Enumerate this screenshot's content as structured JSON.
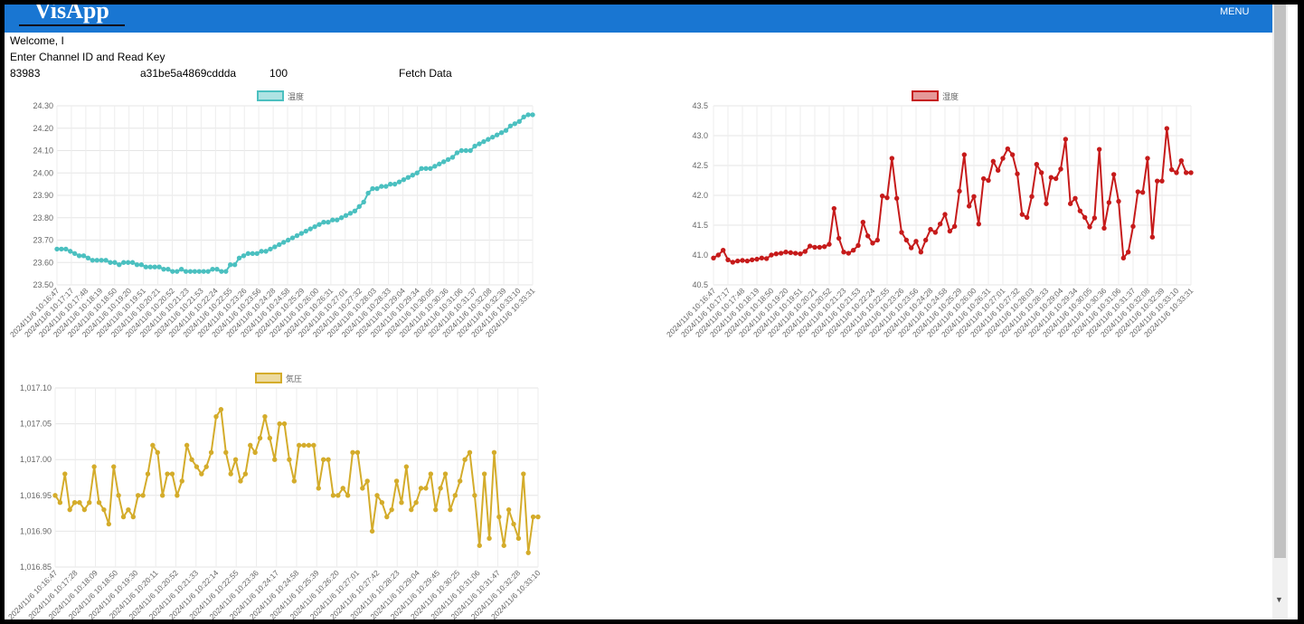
{
  "app": {
    "brand": "VisApp",
    "menu_label": "MENU"
  },
  "page": {
    "welcome": "Welcome, I",
    "prompt": "Enter Channel ID and Read Key",
    "channel_id": "83983",
    "read_key": "a31be5a4869cddda",
    "results": "100",
    "fetch_label": "Fetch Data"
  },
  "chart_data": [
    {
      "type": "line",
      "series": [
        {
          "name": "温度",
          "color": "#4bc0c0",
          "values": [
            23.66,
            23.66,
            23.66,
            23.65,
            23.64,
            23.63,
            23.63,
            23.62,
            23.61,
            23.61,
            23.61,
            23.61,
            23.6,
            23.6,
            23.59,
            23.6,
            23.6,
            23.6,
            23.59,
            23.59,
            23.58,
            23.58,
            23.58,
            23.58,
            23.57,
            23.57,
            23.56,
            23.56,
            23.57,
            23.56,
            23.56,
            23.56,
            23.56,
            23.56,
            23.56,
            23.57,
            23.57,
            23.56,
            23.56,
            23.59,
            23.59,
            23.62,
            23.63,
            23.64,
            23.64,
            23.64,
            23.65,
            23.65,
            23.66,
            23.67,
            23.68,
            23.69,
            23.7,
            23.71,
            23.72,
            23.73,
            23.74,
            23.75,
            23.76,
            23.77,
            23.78,
            23.78,
            23.79,
            23.79,
            23.8,
            23.81,
            23.82,
            23.83,
            23.85,
            23.87,
            23.91,
            23.93,
            23.93,
            23.94,
            23.94,
            23.95,
            23.95,
            23.96,
            23.97,
            23.98,
            23.99,
            24.0,
            24.02,
            24.02,
            24.02,
            24.03,
            24.04,
            24.05,
            24.06,
            24.07,
            24.09,
            24.1,
            24.1,
            24.1,
            24.12,
            24.13,
            24.14,
            24.15,
            24.16,
            24.17,
            24.18,
            24.19,
            24.21,
            24.22,
            24.23,
            24.25,
            24.26,
            24.26
          ]
        }
      ],
      "x_labels": [
        "2024/11/6 10:16:47",
        "2024/11/6 10:17:17",
        "2024/11/6 10:17:48",
        "2024/11/6 10:18:19",
        "2024/11/6 10:18:50",
        "2024/11/6 10:19:20",
        "2024/11/6 10:19:51",
        "2024/11/6 10:20:21",
        "2024/11/6 10:20:52",
        "2024/11/6 10:21:23",
        "2024/11/6 10:21:53",
        "2024/11/6 10:22:24",
        "2024/11/6 10:22:55",
        "2024/11/6 10:23:26",
        "2024/11/6 10:23:56",
        "2024/11/6 10:24:28",
        "2024/11/6 10:24:58",
        "2024/11/6 10:25:29",
        "2024/11/6 10:26:00",
        "2024/11/6 10:26:31",
        "2024/11/6 10:27:01",
        "2024/11/6 10:27:32",
        "2024/11/6 10:28:03",
        "2024/11/6 10:28:33",
        "2024/11/6 10:29:04",
        "2024/11/6 10:29:34",
        "2024/11/6 10:30:05",
        "2024/11/6 10:30:36",
        "2024/11/6 10:31:06",
        "2024/11/6 10:31:37",
        "2024/11/6 10:32:08",
        "2024/11/6 10:32:39",
        "2024/11/6 10:33:10",
        "2024/11/6 10:33:31"
      ],
      "y_ticks": [
        "24.30",
        "24.20",
        "24.10",
        "24.00",
        "23.90",
        "23.80",
        "23.70",
        "23.60",
        "23.50"
      ],
      "ylim": [
        23.5,
        24.3
      ],
      "grid": true,
      "legend_position": "top"
    },
    {
      "type": "line",
      "series": [
        {
          "name": "湿度",
          "color": "#c61b1b",
          "values": [
            40.95,
            41.0,
            41.08,
            40.92,
            40.88,
            40.9,
            40.91,
            40.9,
            40.92,
            40.93,
            40.95,
            40.94,
            41.0,
            41.02,
            41.03,
            41.05,
            41.04,
            41.03,
            41.02,
            41.06,
            41.15,
            41.13,
            41.13,
            41.14,
            41.18,
            41.78,
            41.28,
            41.05,
            41.03,
            41.08,
            41.16,
            41.55,
            41.32,
            41.2,
            41.25,
            41.99,
            41.96,
            42.62,
            41.95,
            41.38,
            41.25,
            41.12,
            41.23,
            41.05,
            41.25,
            41.43,
            41.38,
            41.52,
            41.68,
            41.4,
            41.48,
            42.07,
            42.68,
            41.82,
            41.98,
            41.52,
            42.28,
            42.25,
            42.57,
            42.42,
            42.62,
            42.78,
            42.68,
            42.36,
            41.68,
            41.63,
            41.98,
            42.52,
            42.38,
            41.86,
            42.3,
            42.28,
            42.44,
            42.94,
            41.86,
            41.95,
            41.74,
            41.63,
            41.47,
            41.62,
            42.77,
            41.45,
            41.88,
            42.35,
            41.9,
            40.95,
            41.05,
            41.48,
            42.06,
            42.05,
            42.62,
            41.3,
            42.24,
            42.24,
            43.12,
            42.43,
            42.38,
            42.58,
            42.38,
            42.38
          ]
        }
      ],
      "x_labels": [
        "2024/11/6 10:16:47",
        "2024/11/6 10:17:17",
        "2024/11/6 10:17:48",
        "2024/11/6 10:18:19",
        "2024/11/6 10:18:50",
        "2024/11/6 10:19:20",
        "2024/11/6 10:19:51",
        "2024/11/6 10:20:21",
        "2024/11/6 10:20:52",
        "2024/11/6 10:21:23",
        "2024/11/6 10:21:53",
        "2024/11/6 10:22:24",
        "2024/11/6 10:22:55",
        "2024/11/6 10:23:26",
        "2024/11/6 10:23:56",
        "2024/11/6 10:24:28",
        "2024/11/6 10:24:58",
        "2024/11/6 10:25:29",
        "2024/11/6 10:26:00",
        "2024/11/6 10:26:31",
        "2024/11/6 10:27:01",
        "2024/11/6 10:27:32",
        "2024/11/6 10:28:03",
        "2024/11/6 10:28:33",
        "2024/11/6 10:29:04",
        "2024/11/6 10:29:34",
        "2024/11/6 10:30:05",
        "2024/11/6 10:30:36",
        "2024/11/6 10:31:06",
        "2024/11/6 10:31:37",
        "2024/11/6 10:32:08",
        "2024/11/6 10:32:39",
        "2024/11/6 10:33:10",
        "2024/11/6 10:33:31"
      ],
      "y_ticks": [
        "43.5",
        "43.0",
        "42.5",
        "42.0",
        "41.5",
        "41.0",
        "40.5"
      ],
      "ylim": [
        40.5,
        43.5
      ],
      "grid": true,
      "legend_position": "top"
    },
    {
      "type": "line",
      "series": [
        {
          "name": "気圧",
          "color": "#d4ac2b",
          "values": [
            1016.95,
            1016.94,
            1016.98,
            1016.93,
            1016.94,
            1016.94,
            1016.93,
            1016.94,
            1016.99,
            1016.94,
            1016.93,
            1016.91,
            1016.99,
            1016.95,
            1016.92,
            1016.93,
            1016.92,
            1016.95,
            1016.95,
            1016.98,
            1017.02,
            1017.01,
            1016.95,
            1016.98,
            1016.98,
            1016.95,
            1016.97,
            1017.02,
            1017.0,
            1016.99,
            1016.98,
            1016.99,
            1017.01,
            1017.06,
            1017.07,
            1017.01,
            1016.98,
            1017.0,
            1016.97,
            1016.98,
            1017.02,
            1017.01,
            1017.03,
            1017.06,
            1017.03,
            1017.0,
            1017.05,
            1017.05,
            1017.0,
            1016.97,
            1017.02,
            1017.02,
            1017.02,
            1017.02,
            1016.96,
            1017.0,
            1017.0,
            1016.95,
            1016.95,
            1016.96,
            1016.95,
            1017.01,
            1017.01,
            1016.96,
            1016.97,
            1016.9,
            1016.95,
            1016.94,
            1016.92,
            1016.93,
            1016.97,
            1016.94,
            1016.99,
            1016.93,
            1016.94,
            1016.96,
            1016.96,
            1016.98,
            1016.93,
            1016.96,
            1016.98,
            1016.93,
            1016.95,
            1016.97,
            1017.0,
            1017.01,
            1016.95,
            1016.88,
            1016.98,
            1016.89,
            1017.01,
            1016.92,
            1016.88,
            1016.93,
            1016.91,
            1016.89,
            1016.98,
            1016.87,
            1016.92,
            1016.92
          ]
        }
      ],
      "x_labels": [
        "2024/11/6 10:16:47",
        "2024/11/6 10:17:28",
        "2024/11/6 10:18:09",
        "2024/11/6 10:18:50",
        "2024/11/6 10:19:30",
        "2024/11/6 10:20:11",
        "2024/11/6 10:20:52",
        "2024/11/6 10:21:33",
        "2024/11/6 10:22:14",
        "2024/11/6 10:22:55",
        "2024/11/6 10:23:36",
        "2024/11/6 10:24:17",
        "2024/11/6 10:24:58",
        "2024/11/6 10:25:39",
        "2024/11/6 10:26:20",
        "2024/11/6 10:27:01",
        "2024/11/6 10:27:42",
        "2024/11/6 10:28:23",
        "2024/11/6 10:29:04",
        "2024/11/6 10:29:45",
        "2024/11/6 10:30:25",
        "2024/11/6 10:31:06",
        "2024/11/6 10:31:47",
        "2024/11/6 10:32:28",
        "2024/11/6 10:33:10"
      ],
      "y_ticks": [
        "1,017.10",
        "1,017.05",
        "1,017.00",
        "1,016.95",
        "1,016.90",
        "1,016.85"
      ],
      "ylim": [
        1016.85,
        1017.1
      ],
      "grid": true,
      "legend_position": "top"
    }
  ]
}
